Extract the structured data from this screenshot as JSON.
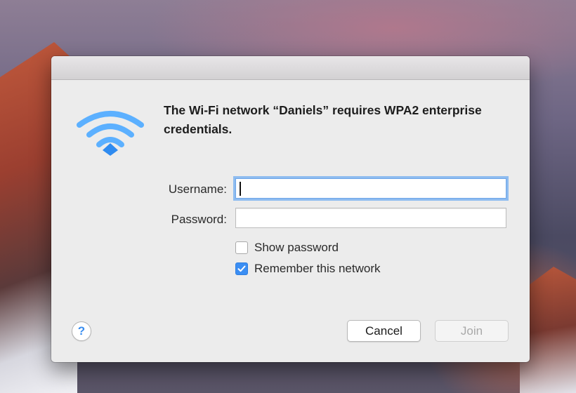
{
  "dialog": {
    "message": "The Wi-Fi network “Daniels” requires WPA2 enterprise credentials.",
    "icon": "wifi-icon",
    "accent_color": "#3b8ef3"
  },
  "form": {
    "username_label": "Username:",
    "username_value": "",
    "password_label": "Password:",
    "password_value": "",
    "show_password_label": "Show password",
    "show_password_checked": false,
    "remember_label": "Remember this network",
    "remember_checked": true
  },
  "buttons": {
    "help_label": "?",
    "cancel_label": "Cancel",
    "join_label": "Join"
  }
}
